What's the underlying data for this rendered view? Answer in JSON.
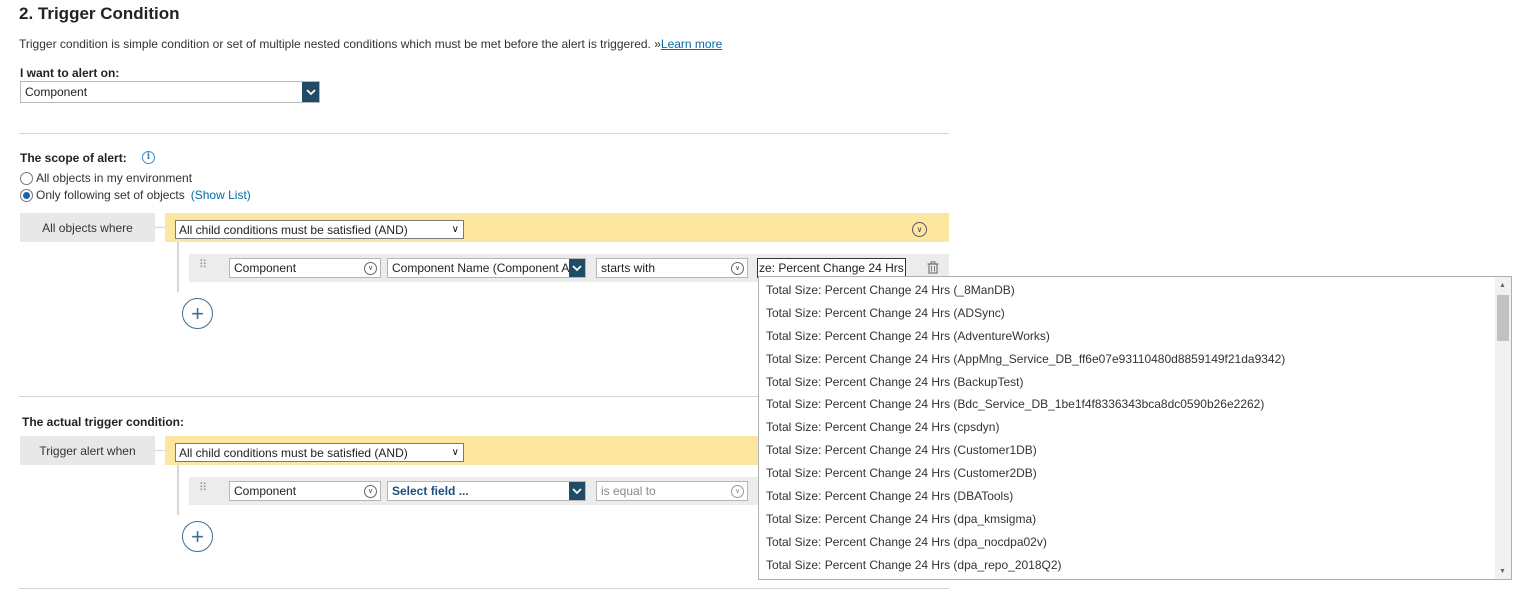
{
  "section": {
    "title": "2. Trigger Condition",
    "description": "Trigger condition is simple condition or set of multiple nested conditions which must be met before the alert is triggered. »",
    "learn_more": "Learn more"
  },
  "alert_on": {
    "label": "I want to alert on:",
    "value": "Component"
  },
  "scope": {
    "label": "The scope of alert:",
    "option_all": "All objects in my environment",
    "option_following": "Only following set of objects",
    "show_list": "(Show List)",
    "selected": "Only following set of objects",
    "group_label": "All objects where",
    "group_operator": "All child conditions must be satisfied (AND)",
    "condition": {
      "object": "Component",
      "field": "Component Name (Component A",
      "operator": "starts with",
      "value": "ze: Percent Change 24 Hrs"
    }
  },
  "trigger": {
    "label": "The actual trigger condition:",
    "group_label": "Trigger alert when",
    "group_operator": "All child conditions must be satisfied (AND)",
    "condition": {
      "object": "Component",
      "field": "Select field ...",
      "operator": "is equal to"
    }
  },
  "autocomplete": {
    "items": [
      "Total Size: Percent Change 24 Hrs (_8ManDB)",
      "Total Size: Percent Change 24 Hrs (ADSync)",
      "Total Size: Percent Change 24 Hrs (AdventureWorks)",
      "Total Size: Percent Change 24 Hrs (AppMng_Service_DB_ff6e07e93110480d8859149f21da9342)",
      "Total Size: Percent Change 24 Hrs (BackupTest)",
      "Total Size: Percent Change 24 Hrs (Bdc_Service_DB_1be1f4f8336343bca8dc0590b26e2262)",
      "Total Size: Percent Change 24 Hrs (cpsdyn)",
      "Total Size: Percent Change 24 Hrs (Customer1DB)",
      "Total Size: Percent Change 24 Hrs (Customer2DB)",
      "Total Size: Percent Change 24 Hrs (DBATools)",
      "Total Size: Percent Change 24 Hrs (dpa_kmsigma)",
      "Total Size: Percent Change 24 Hrs (dpa_nocdpa02v)",
      "Total Size: Percent Change 24 Hrs (dpa_repo_2018Q2)"
    ]
  },
  "colors": {
    "accent": "#204a66",
    "link": "#006ca9",
    "group_bar": "#fce6a0",
    "group_tab": "#e8e8e8"
  }
}
